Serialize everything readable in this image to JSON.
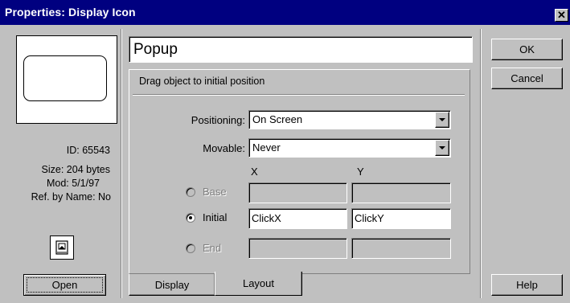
{
  "window": {
    "title": "Properties: Display Icon",
    "close_glyph": "✕"
  },
  "left": {
    "id_label": "ID: 65543",
    "size_label": "Size: 204 bytes",
    "mod_label": "Mod: 5/1/97",
    "ref_label": "Ref. by Name: No",
    "icon_name": "display-icon",
    "open_label": "Open"
  },
  "main": {
    "icon_title": "Popup",
    "instruction": "Drag object to initial position",
    "positioning": {
      "label": "Positioning:",
      "value": "On Screen"
    },
    "movable": {
      "label": "Movable:",
      "value": "Never"
    },
    "col_x": "X",
    "col_y": "Y",
    "rows": [
      {
        "label": "Base",
        "selected": false,
        "enabled": false,
        "x": "",
        "y": ""
      },
      {
        "label": "Initial",
        "selected": true,
        "enabled": true,
        "x": "ClickX",
        "y": "ClickY"
      },
      {
        "label": "End",
        "selected": false,
        "enabled": false,
        "x": "",
        "y": ""
      }
    ],
    "tabs": [
      {
        "label": "Display",
        "active": false
      },
      {
        "label": "Layout",
        "active": true
      }
    ]
  },
  "buttons": {
    "ok": "OK",
    "cancel": "Cancel",
    "help": "Help"
  },
  "colors": {
    "titlebar": "#000080",
    "face": "#c0c0c0",
    "disabled_text": "#808080"
  }
}
